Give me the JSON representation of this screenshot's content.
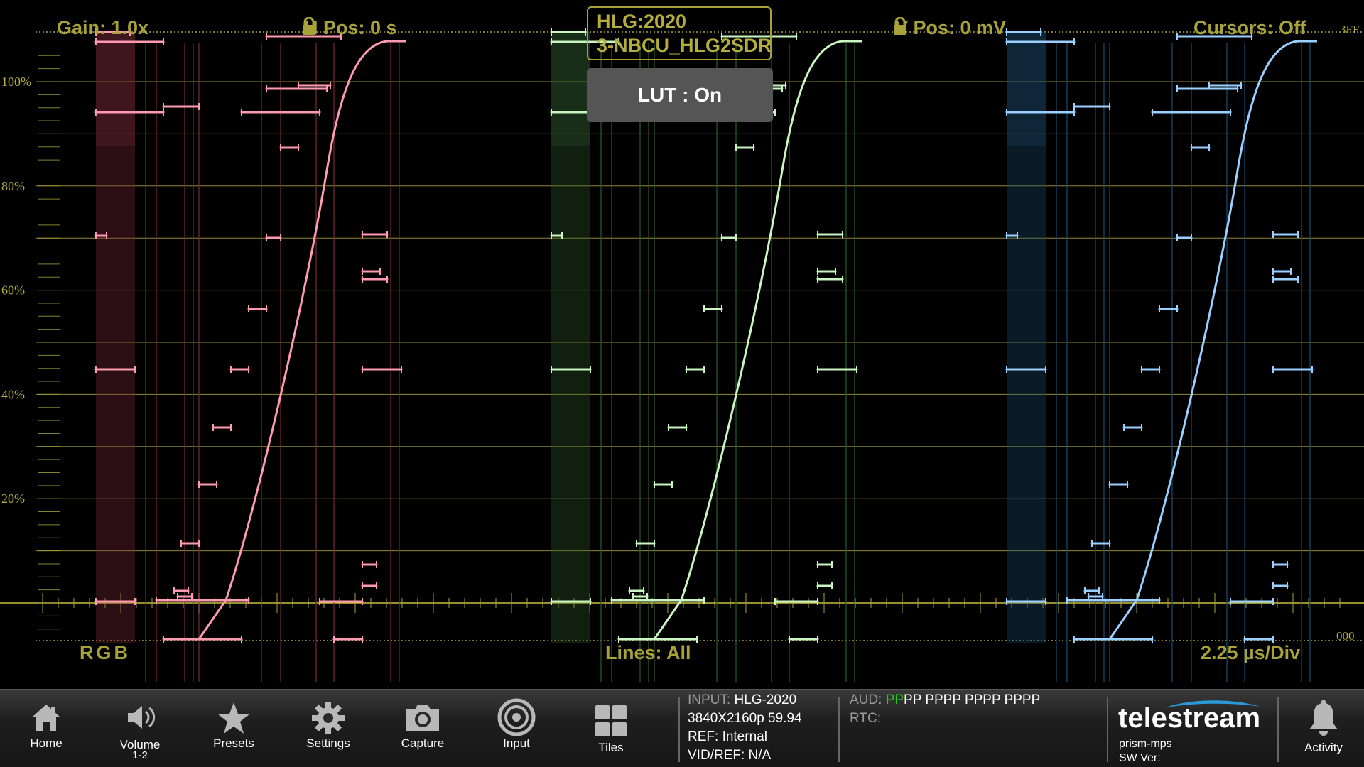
{
  "scope": {
    "gain": "Gain: 1.0x",
    "h_pos": "H Pos: 0 s",
    "v_pos": "V Pos: 0 mV",
    "cursors": "Cursors: Off",
    "top_right_code": "3FF",
    "bottom_right_code": "000",
    "format_line1": "HLG:2020",
    "format_line2": "3-NBCU_HLG2SDR",
    "lut": "LUT : On",
    "mode": "RGB",
    "lines": "Lines: All",
    "timebase": "2.25 µs/Div",
    "y_ticks": [
      "100%",
      "80%",
      "60%",
      "40%",
      "20%"
    ],
    "y_tick_values": [
      100,
      80,
      60,
      40,
      20
    ],
    "channel_colors": {
      "r": "#ff9ab0",
      "g": "#c8f5c0",
      "b": "#9ad0ff"
    },
    "graticule_color": "#a8a23a"
  },
  "taskbar": {
    "home": "Home",
    "volume": "Volume",
    "volume_sub": "1-2",
    "presets": "Presets",
    "settings": "Settings",
    "capture": "Capture",
    "input": "Input",
    "tiles": "Tiles",
    "activity": "Activity"
  },
  "status": {
    "input_key": "INPUT:",
    "input_val": "HLG-2020",
    "format": "3840X2160p 59.94",
    "ref_key": "REF:",
    "ref_val": "Internal",
    "vidref_key": "VID/REF:",
    "vidref_val": "N/A",
    "aud_key": "AUD:",
    "aud_ok": "PP",
    "aud_rest": "PP PPPP PPPP PPPP",
    "rtc_key": "RTC:",
    "aud_ok_color": "#22cc22"
  },
  "brand": {
    "name": "telestream",
    "product": "prism-mps",
    "sw": "SW Ver:"
  }
}
